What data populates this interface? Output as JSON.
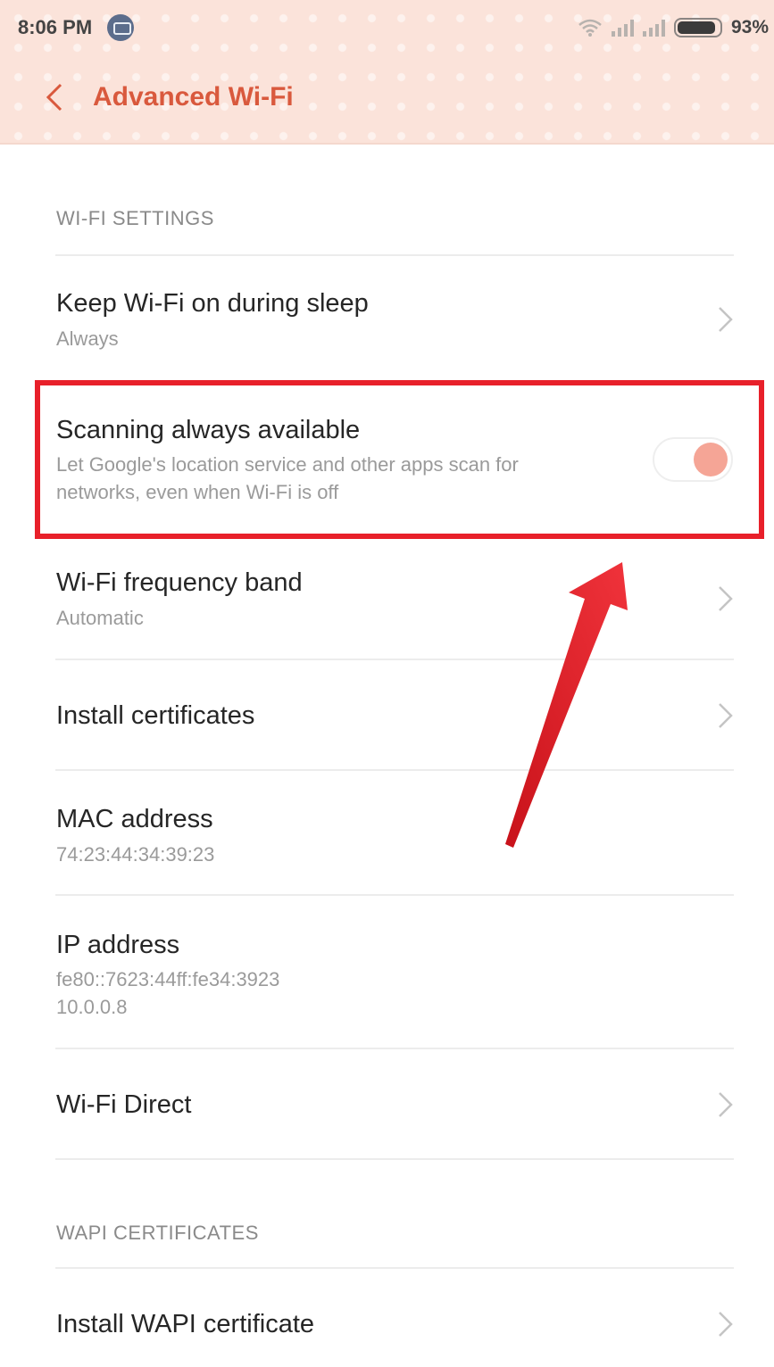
{
  "status_bar": {
    "time": "8:06 PM",
    "battery": "93%",
    "icons": [
      "notification-icon",
      "wifi-icon",
      "signal-icon",
      "signal-icon",
      "battery-icon"
    ]
  },
  "header": {
    "title": "Advanced Wi-Fi",
    "back_icon": "back-chevron-icon"
  },
  "sections": {
    "wifi_settings": "WI-FI SETTINGS",
    "wapi_certificates": "WAPI CERTIFICATES"
  },
  "rows": {
    "keep_wifi": {
      "title": "Keep Wi-Fi on during sleep",
      "subtitle": "Always"
    },
    "scanning": {
      "title": "Scanning always available",
      "subtitle_line1": "Let Google's location service and other apps scan for",
      "subtitle_line2": "networks, even when Wi-Fi is off",
      "toggle_on": true
    },
    "frequency": {
      "title": "Wi-Fi frequency band",
      "subtitle": "Automatic"
    },
    "certificates": {
      "title": "Install certificates"
    },
    "mac": {
      "title": "MAC address",
      "value": "74:23:44:34:39:23"
    },
    "ip": {
      "title": "IP address",
      "value_line1": "fe80::7623:44ff:fe34:3923",
      "value_line2": "10.0.0.8"
    },
    "direct": {
      "title": "Wi-Fi Direct"
    },
    "wapi_install": {
      "title": "Install WAPI certificate"
    }
  },
  "colors": {
    "header_bg": "#fbe3da",
    "title_accent": "#d9593d",
    "highlight": "#e8202a",
    "toggle_knob": "#f5a596"
  }
}
